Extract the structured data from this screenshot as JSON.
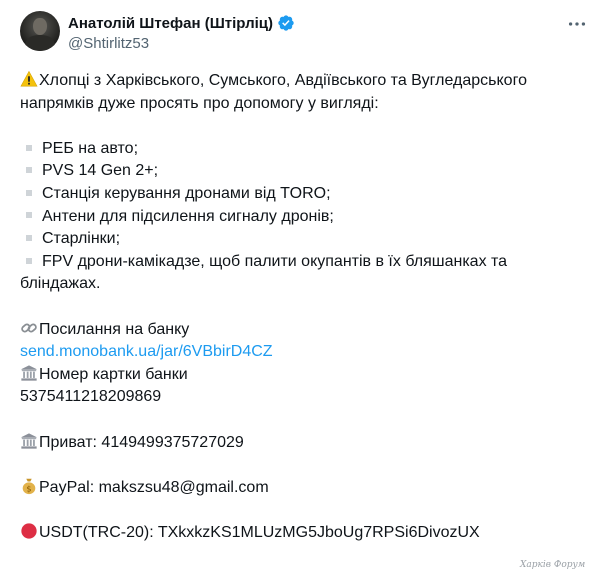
{
  "author": {
    "display_name": "Анатолій Штефан (Штірліц)",
    "handle": "@Shtirlitz53",
    "verified": true,
    "verified_color": "#1d9bf0"
  },
  "tweet": {
    "intro_line1": "Хлопці з Харківського, Сумського, Авдіївського та Вугледарського",
    "intro_line2": "напрямків дуже просять про допомогу у вигляді:",
    "items": [
      "РЕБ на авто;",
      "PVS 14 Gen 2+;",
      "Станція керування дронами від TORO;",
      "Антени для підсилення сигналу дронів;",
      "Старлінки;",
      "FPV дрони-камікадзе, щоб палити окупантів в їх бляшанках та"
    ],
    "item_continuation": "бліндажах.",
    "bank_link_label": "Посилання на банку",
    "bank_link": "send.monobank.ua/jar/6VBbirD4CZ",
    "card_label": "Номер картки банки",
    "card_number": "5375411218209869",
    "privat": "Приват: 4149499375727029",
    "paypal": "PayPal: makszsu48@gmail.com",
    "usdt": "USDT(TRC-20): TXkxkzKS1MLUzMG5JboUg7RPSi6DivozUX",
    "link_color": "#1d9bf0"
  },
  "icons": {
    "header": [
      "verified-badge-icon",
      "more-options-icon"
    ],
    "content": [
      "warning-icon",
      "link-icon",
      "bank-icon",
      "money-bag-icon",
      "red-circle-icon"
    ]
  },
  "watermark": "Харків Форум"
}
